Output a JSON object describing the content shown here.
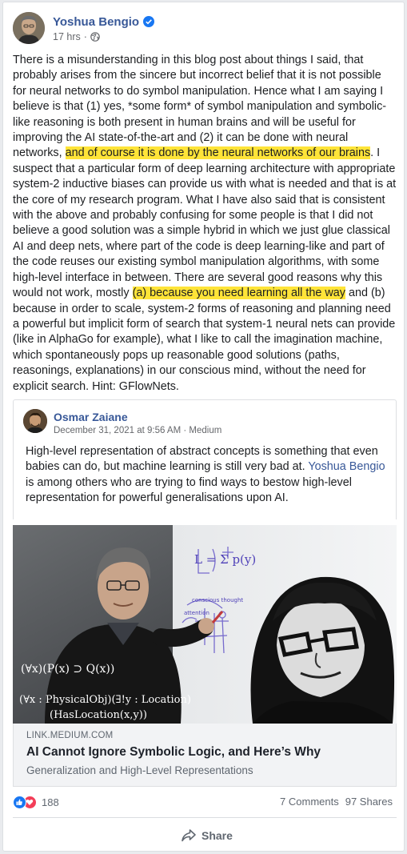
{
  "post": {
    "author": "Yoshua Bengio",
    "time": "17 hrs",
    "dot": "·",
    "text_1": "There is a misunderstanding in this blog post about things I said, that probably arises from the sincere but incorrect belief that it is not possible for neural networks to do symbol manipulation. Hence what I am saying I believe is that (1) yes, *some form* of symbol manipulation and symbolic-like reasoning is both present in human brains and will be useful for improving the AI state-of-the-art and (2) it can be done with neural networks, ",
    "highlight_1": "and of course it is done by the neural networks of our brains",
    "text_2": ". I suspect that a particular form of deep learning architecture with appropriate system-2 inductive biases can provide us with what is needed and that is at the core of my research program. What I have also said that is consistent with the above and probably confusing for some people is that I did not believe a good solution was a simple hybrid in which we just glue classical AI and deep nets, where part of the code is deep learning-like and part of the code reuses our existing symbol manipulation algorithms, with some high-level interface in between. There are several good reasons why this would not work, mostly ",
    "highlight_2": "(a) because you need learning all the way",
    "text_3": " and (b) because in order to scale, system-2 forms of reasoning and planning need a powerful but implicit form of search that system-1 neural nets can provide (like in AlphaGo for example), what I like to call the imagination machine, which spontaneously pops up reasonable good solutions (paths, reasonings, explanations) in our conscious mind, without the need for explicit search. Hint: GFlowNets."
  },
  "shared": {
    "author": "Osmar Zaiane",
    "meta": "December 31, 2021 at 9:56 AM · Medium",
    "text_1": "High-level representation of abstract concepts is something that even babies can do, but machine learning is still very bad at. ",
    "mention": "Yoshua Bengio",
    "text_2": " is among others who are trying to find ways to bestow high-level representation for powerful generalisations upon AI."
  },
  "link_preview": {
    "formula_1": "(∀x)(P(x) ⊃ Q(x))",
    "formula_2": "(∀x : PhysicalObj)(∃!y : Location)",
    "formula_3": "(HasLocation(x,y))",
    "board_1": "L = Σ p(y)",
    "board_2": "conscious thought",
    "board_3": "attention",
    "domain": "LINK.MEDIUM.COM",
    "title": "AI Cannot Ignore Symbolic Logic, and Here’s Why",
    "subtitle": "Generalization and High-Level Representations"
  },
  "engagement": {
    "reaction_count": "188",
    "comments": "7 Comments",
    "shares": "97 Shares",
    "share_label": "Share"
  },
  "colors": {
    "link": "#385898",
    "highlight": "#ffe438",
    "like": "#1877f2",
    "love": "#f33e58"
  },
  "icons": [
    "verified-badge-icon",
    "globe-icon",
    "like-reaction-icon",
    "love-reaction-icon",
    "share-arrow-icon"
  ]
}
